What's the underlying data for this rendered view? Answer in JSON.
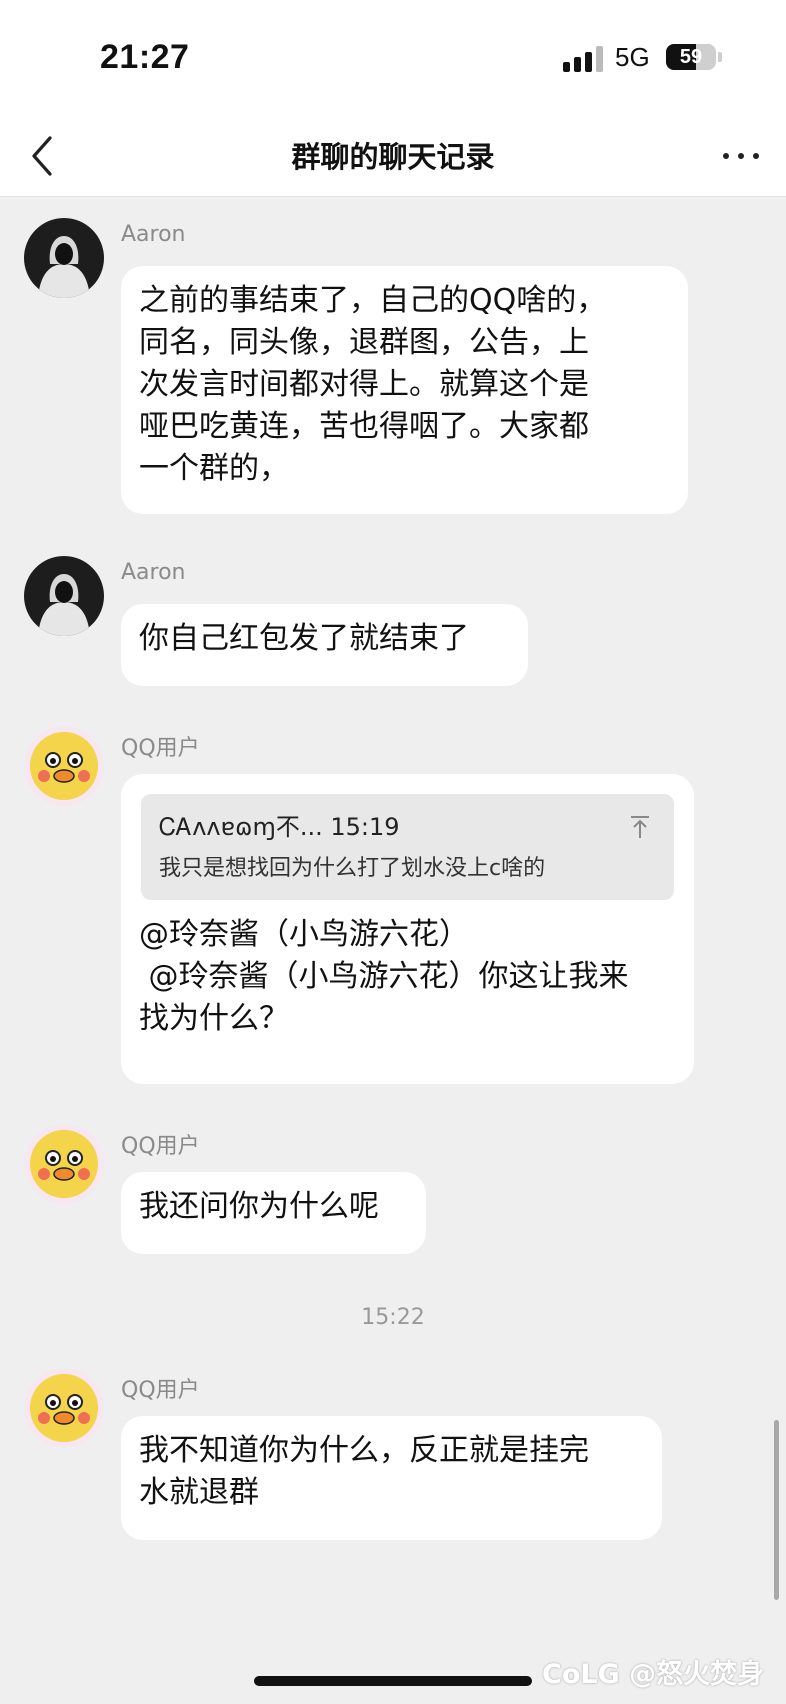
{
  "status": {
    "time": "21:27",
    "network": "5G",
    "battery": "59",
    "battery_level": 0.59
  },
  "nav": {
    "title": "群聊的聊天记录"
  },
  "messages": [
    {
      "sender": "Aaron",
      "text": "之前的事结束了，自己的QQ啥的，\n同名，同头像，退群图，公告，上\n次发言时间都对得上。就算这个是\n哑巴吃黄连，苦也得咽了。大家都\n一个群的，"
    },
    {
      "sender": "Aaron",
      "text": "你自己红包发了就结束了"
    },
    {
      "sender": "QQ用户",
      "quote": {
        "head": "ᏟᎪʌʌɐɷɱ不... 15:19",
        "text": "我只是想找回为什么打了划水没上c啥的"
      },
      "text": "@玲奈酱（小鸟游六花）\n @玲奈酱（小鸟游六花）你这让我来\n找为什么？"
    },
    {
      "sender": "QQ用户",
      "text": "我还问你为什么呢"
    },
    {
      "sender": "QQ用户",
      "text": "我不知道你为什么，反正就是挂完\n水就退群"
    }
  ],
  "timestamp": "15:22",
  "watermark": "CoLG @怒火焚身"
}
